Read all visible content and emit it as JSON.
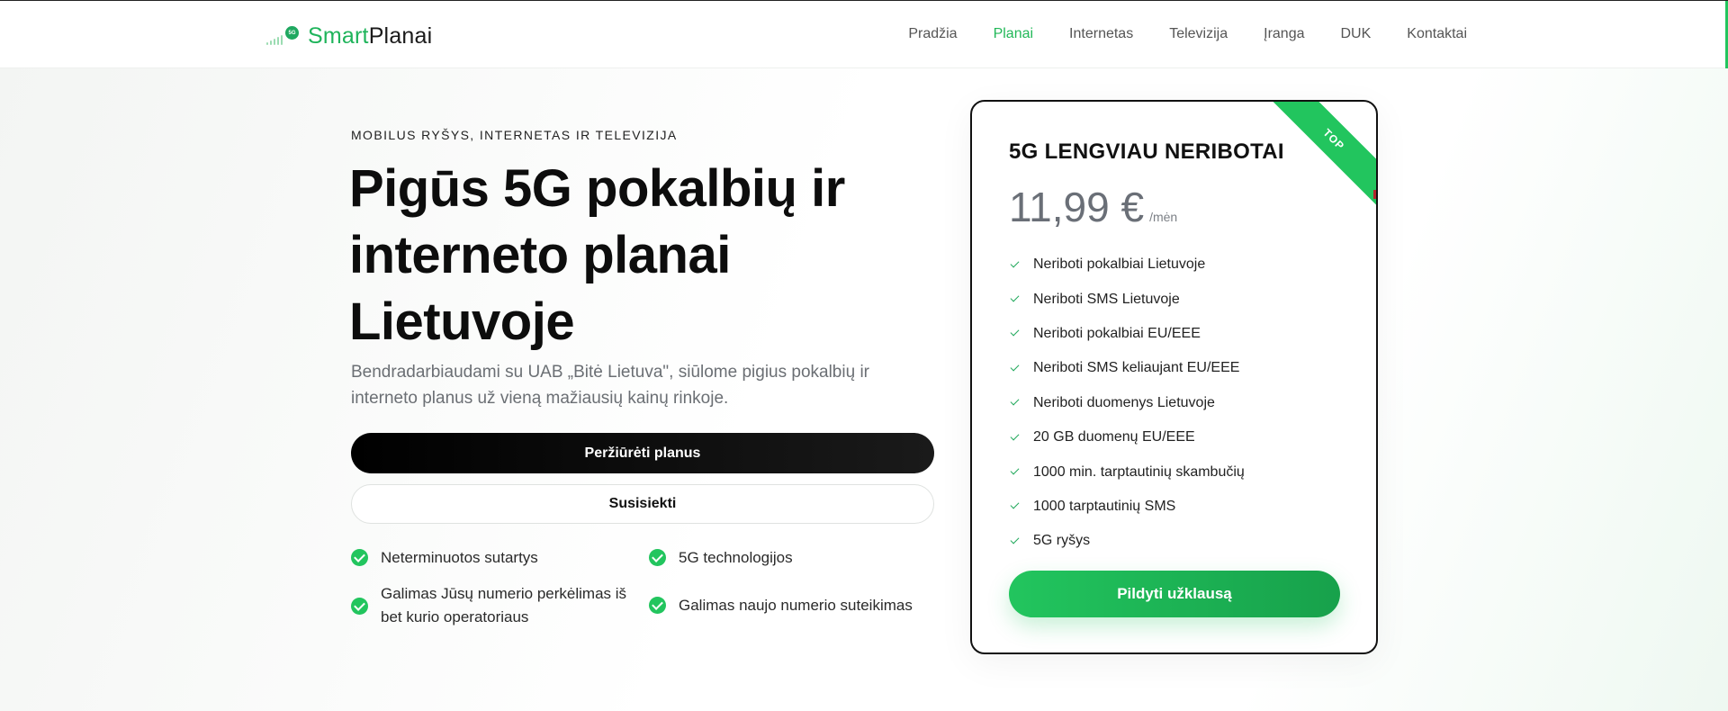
{
  "brand": {
    "smart": "Smart",
    "planai": "Planai",
    "badge": "5G"
  },
  "nav": {
    "items": [
      "Pradžia",
      "Planai",
      "Internetas",
      "Televizija",
      "Įranga",
      "DUK",
      "Kontaktai"
    ],
    "active": "Planai"
  },
  "hero": {
    "eyebrow": "MOBILUS RYŠYS, INTERNETAS IR TELEVIZIJA",
    "headline": "Pigūs 5G pokalbių ir interneto planai Lietuvoje",
    "subtitle": "Bendradarbiaudami su UAB „Bitė Lietuva\", siūlome pigius pokalbių ir interneto planus už vieną mažiausių kainų rinkoje.",
    "primary_button": "Peržiūrėti planus",
    "secondary_button": "Susisiekti",
    "features": [
      "Neterminuotos sutartys",
      "5G technologijos",
      "Galimas Jūsų numerio perkėlimas iš bet kurio operatoriaus",
      "Galimas naujo numerio suteikimas"
    ]
  },
  "plan_card": {
    "ribbon": "TOP",
    "title": "5G LENGVIAU NERIBOTAI",
    "price": "11,99 €",
    "price_unit": "/mėn",
    "items": [
      "Neriboti pokalbiai Lietuvoje",
      "Neriboti SMS Lietuvoje",
      "Neriboti pokalbiai EU/EEE",
      "Neriboti SMS keliaujant EU/EEE",
      "Neriboti duomenys Lietuvoje",
      "20 GB duomenų EU/EEE",
      "1000 min. tarptautinių skambučių",
      "1000 tarptautinių SMS",
      "5G ryšys"
    ],
    "button": "Pildyti užklausą"
  },
  "colors": {
    "accent": "#22c55e",
    "text_dark": "#111111",
    "muted": "#6b6f74"
  }
}
